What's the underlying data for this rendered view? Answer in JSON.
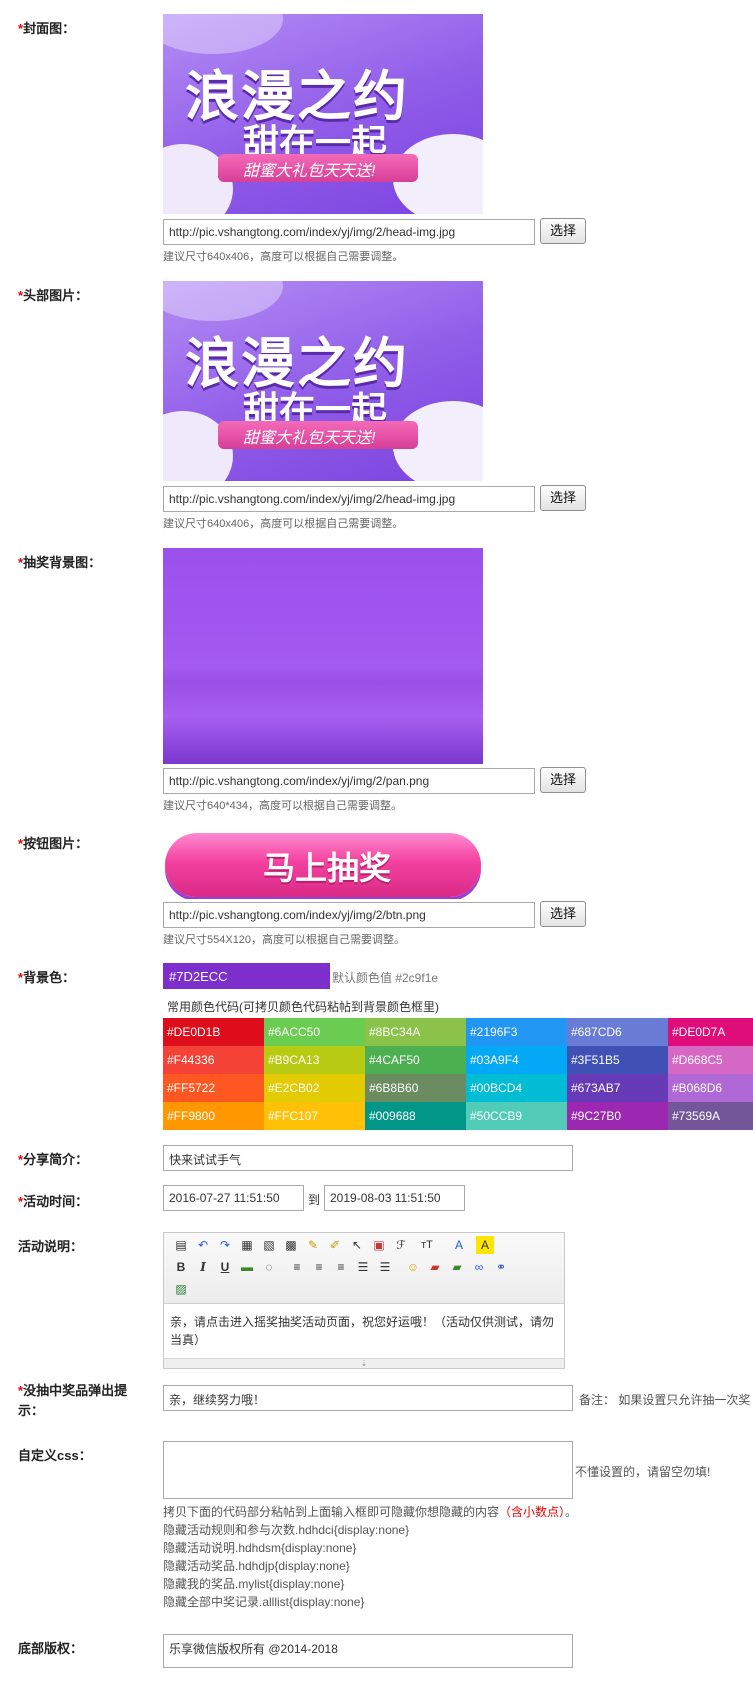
{
  "fields": {
    "cover": {
      "label": "封面图：",
      "url": "http://pic.vshangtong.com/index/yj/img/2/head-img.jpg",
      "button": "选择",
      "hint": "建议尺寸640x406，高度可以根据自己需要调整。",
      "banner_title": "浪漫之约",
      "banner_sub": "甜在一起",
      "banner_ribbon": "甜蜜大礼包天天送!"
    },
    "header": {
      "label": "头部图片：",
      "url": "http://pic.vshangtong.com/index/yj/img/2/head-img.jpg",
      "button": "选择",
      "hint": "建议尺寸640x406，高度可以根据自己需要调整。",
      "banner_title": "浪漫之约",
      "banner_sub": "甜在一起",
      "banner_ribbon": "甜蜜大礼包天天送!"
    },
    "lottery_bg": {
      "label": "抽奖背景图：",
      "url": "http://pic.vshangtong.com/index/yj/img/2/pan.png",
      "button": "选择",
      "hint": "建议尺寸640*434，高度可以根据自己需要调整。"
    },
    "button_img": {
      "label": "按钮图片：",
      "btn_text": "马上抽奖",
      "url": "http://pic.vshangtong.com/index/yj/img/2/btn.png",
      "button": "选择",
      "hint": "建议尺寸554X120，高度可以根据自己需要调整。"
    },
    "bg_color": {
      "label": "背景色：",
      "value": "#7D2ECC",
      "default_note": "默认颜色值 #2c9f1e",
      "palette_title": "常用颜色代码(可拷贝颜色代码粘帖到背景颜色框里)",
      "palette": [
        [
          "#DE0D1B",
          "#6ACC50",
          "#8BC34A",
          "#2196F3",
          "#687CD6",
          "#DE0D7A"
        ],
        [
          "#F44336",
          "#B9CA13",
          "#4CAF50",
          "#03A9F4",
          "#3F51B5",
          "#D668C5"
        ],
        [
          "#FF5722",
          "#E2CB02",
          "#6B8B60",
          "#00BCD4",
          "#673AB7",
          "#B068D6"
        ],
        [
          "#FF9800",
          "#FFC107",
          "#009688",
          "#50CCB9",
          "#9C27B0",
          "#73569A"
        ]
      ]
    },
    "share": {
      "label": "分享简介：",
      "value": "快来试试手气"
    },
    "time": {
      "label": "活动时间：",
      "start": "2016-07-27 11:51:50",
      "sep": "到",
      "end": "2019-08-03  11:51:50"
    },
    "desc": {
      "label": "活动说明：",
      "content": "亲，请点击进入摇奖抽奖活动页面，祝您好运哦！（活动仅供测试，请勿当真）"
    },
    "no_prize": {
      "label_line1": "没抽中奖品弹出提",
      "label_line2": "示：",
      "value": "亲，继续努力哦！",
      "note": "备注： 如果设置只允许抽一次奖"
    },
    "css": {
      "label": "自定义css：",
      "side_note": "不懂设置的，请留空勿填!",
      "help_head": "拷贝下面的代码部分粘帖到上面输入框即可隐藏你想隐藏的内容",
      "help_warn": "（含小数点）",
      "help_end": "。",
      "lines": [
        "隐藏活动规则和参与次数.hdhdci{display:none}",
        "隐藏活动说明.hdhdsm{display:none}",
        "隐藏活动奖品.hdhdjp{display:none}",
        "隐藏我的奖品.mylist{display:none}",
        "隐藏全部中奖记录.alllist{display:none}"
      ]
    },
    "footer": {
      "label": "底部版权：",
      "value": "乐享微信版权所有 @2014-2018"
    }
  },
  "colors": {
    "required": "#ee0000",
    "banner_purple": "#8b55e8",
    "bg_value": "#7D2ECC"
  }
}
